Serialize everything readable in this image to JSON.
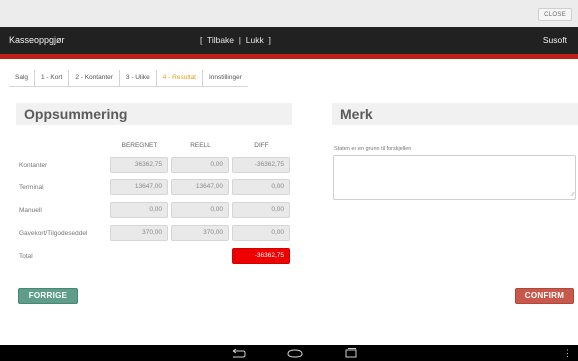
{
  "window": {
    "close_label": "CLOSE"
  },
  "appbar": {
    "title": "Kasseoppgjør",
    "nav_open": "[",
    "nav_back": "Tilbake",
    "nav_sep": "|",
    "nav_close": "Lukk",
    "nav_end": "]",
    "brand": "Susoft"
  },
  "tabs": [
    {
      "label": "Salg"
    },
    {
      "label": "1 - Kort"
    },
    {
      "label": "2 - Kontanter"
    },
    {
      "label": "3 - Ulike"
    },
    {
      "label": "4 - Resultat",
      "active": true
    },
    {
      "label": "Innstillinger"
    }
  ],
  "summary": {
    "title": "Oppsummering",
    "columns": [
      "BEREGNET",
      "REELL",
      "DIFF"
    ],
    "rows": [
      {
        "label": "Kontanter",
        "beregnet": "36362,75",
        "reell": "0,00",
        "diff": "-36362,75"
      },
      {
        "label": "Terminal",
        "beregnet": "13647,00",
        "reell": "13647,00",
        "diff": "0,00"
      },
      {
        "label": "Manuell",
        "beregnet": "0,00",
        "reell": "0,00",
        "diff": "0,00"
      },
      {
        "label": "Gavekort/Tilgodeseddel",
        "beregnet": "370,00",
        "reell": "370,00",
        "diff": "0,00"
      }
    ],
    "total": {
      "label": "Total",
      "diff": "-36362,75"
    }
  },
  "merk": {
    "title": "Merk",
    "label": "Staten er en grunn til forskjellen",
    "value": ""
  },
  "buttons": {
    "prev": "FORRIGE",
    "confirm": "CONFIRM"
  },
  "colors": {
    "accent_red": "#c0221b",
    "active_tab": "#e39f1f",
    "prev_button": "#5e9d8a",
    "confirm_button": "#c9584c",
    "negative_total": "#ee0000"
  },
  "system_nav": {
    "back_icon": "back-icon",
    "home_icon": "home-icon",
    "recents_icon": "recents-icon",
    "menu_icon": "menu-icon"
  }
}
